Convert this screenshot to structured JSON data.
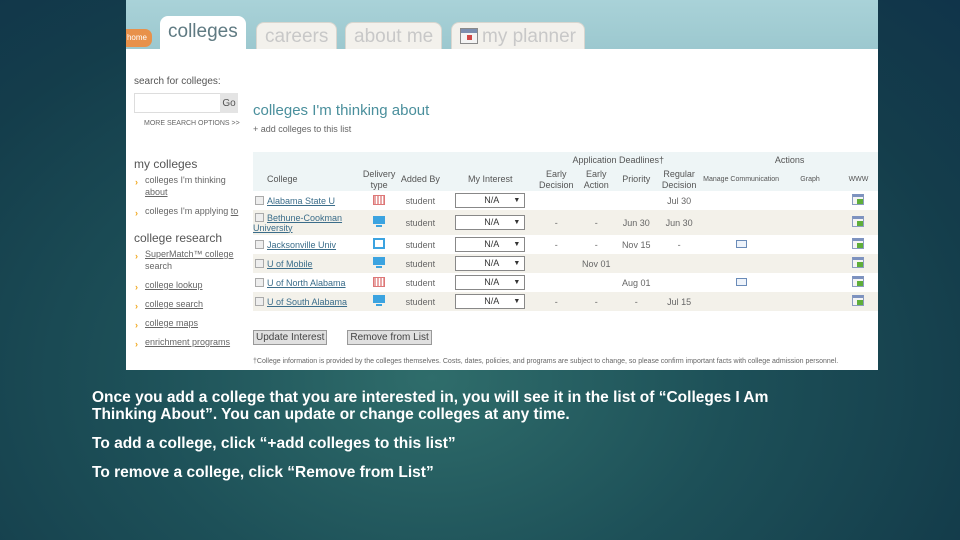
{
  "nav": {
    "home_label": "home",
    "tabs": [
      {
        "label": "colleges",
        "active": true
      },
      {
        "label": "careers",
        "active": false
      },
      {
        "label": "about me",
        "active": false
      },
      {
        "label": "my planner",
        "active": false,
        "icon": "planner-icon"
      }
    ]
  },
  "sidebar": {
    "search_label": "search for colleges:",
    "search_value": "",
    "go_label": "Go",
    "more_options": "MORE SEARCH OPTIONS >>",
    "my_colleges": {
      "heading": "my colleges",
      "items": [
        {
          "label": "colleges I'm thinking ",
          "link": "about"
        },
        {
          "label": "colleges I'm applying ",
          "link": "to"
        }
      ]
    },
    "research": {
      "heading": "college research",
      "items": [
        {
          "label": "SuperMatch™ college",
          "sub": "search"
        },
        {
          "label": "college lookup"
        },
        {
          "label": "college search"
        },
        {
          "label": "college maps"
        },
        {
          "label": "enrichment programs"
        }
      ]
    }
  },
  "main": {
    "title": "colleges I'm thinking about",
    "add_link": "+ add colleges to this list",
    "group_headers": {
      "deadlines": "Application Deadlines†",
      "actions": "Actions"
    },
    "columns": [
      "College",
      "Delivery type",
      "Added By",
      "My Interest",
      "Early Decision",
      "Early Action",
      "Priority",
      "Regular Decision",
      "Manage Communication",
      "Graph",
      "WWW"
    ],
    "rows": [
      {
        "college": "Alabama State U",
        "delivery": "campus",
        "added_by": "student",
        "interest": "N/A",
        "early_decision": "",
        "early_action": "",
        "priority": "",
        "regular": "Jul 30",
        "manage": false
      },
      {
        "college": "Bethune-Cookman University",
        "delivery": "online",
        "added_by": "student",
        "interest": "N/A",
        "early_decision": "-",
        "early_action": "-",
        "priority": "Jun 30",
        "regular": "Jun 30",
        "manage": false
      },
      {
        "college": "Jacksonville Univ",
        "delivery": "hybrid",
        "added_by": "student",
        "interest": "N/A",
        "early_decision": "-",
        "early_action": "-",
        "priority": "Nov 15",
        "regular": "-",
        "manage": true
      },
      {
        "college": "U of Mobile",
        "delivery": "online",
        "added_by": "student",
        "interest": "N/A",
        "early_decision": "",
        "early_action": "Nov 01",
        "priority": "",
        "regular": "",
        "manage": false
      },
      {
        "college": "U of North Alabama",
        "delivery": "campus",
        "added_by": "student",
        "interest": "N/A",
        "early_decision": "",
        "early_action": "",
        "priority": "Aug 01",
        "regular": "",
        "manage": true
      },
      {
        "college": "U of South Alabama",
        "delivery": "online",
        "added_by": "student",
        "interest": "N/A",
        "early_decision": "-",
        "early_action": "-",
        "priority": "-",
        "regular": "Jul 15",
        "manage": false
      }
    ],
    "update_button": "Update Interest",
    "remove_button": "Remove from List",
    "footnote": "†College information is provided by the colleges themselves. Costs, dates, policies, and programs are subject to change, so please confirm important facts with college admission personnel."
  },
  "caption": {
    "paragraph1": "Once you add a college that you are interested in, you will see it in the list of “Colleges I Am Thinking About”. You can update or change colleges at any time.",
    "paragraph2": "To add a college, click “+add colleges to this list”",
    "paragraph3": "To remove a college, click “Remove from List”"
  }
}
